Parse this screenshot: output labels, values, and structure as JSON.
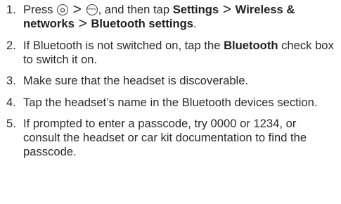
{
  "steps": [
    {
      "number": "1.",
      "part1": "Press",
      "sep1": ">",
      "part2": ", and then tap",
      "bold1": "Settings",
      "sep2": ">",
      "bold2": "Wireless & networks",
      "sep3": ">",
      "bold3": "Bluetooth settings",
      "end": ".",
      "icons": [
        "home-key-icon",
        "menu-key-icon"
      ],
      "menu_key_text": "menu"
    },
    {
      "number": "2.",
      "part1": "If Bluetooth is not switched on, tap the",
      "bold1": "Bluetooth",
      "part2": "check box to switch it on."
    },
    {
      "number": "3.",
      "text": "Make sure that the headset is discoverable."
    },
    {
      "number": "4.",
      "text": "Tap the headset’s name in the Bluetooth devices section."
    },
    {
      "number": "5.",
      "text": "If prompted to enter a passcode, try 0000 or 1234, or consult the headset or car kit documentation to find the passcode."
    }
  ]
}
